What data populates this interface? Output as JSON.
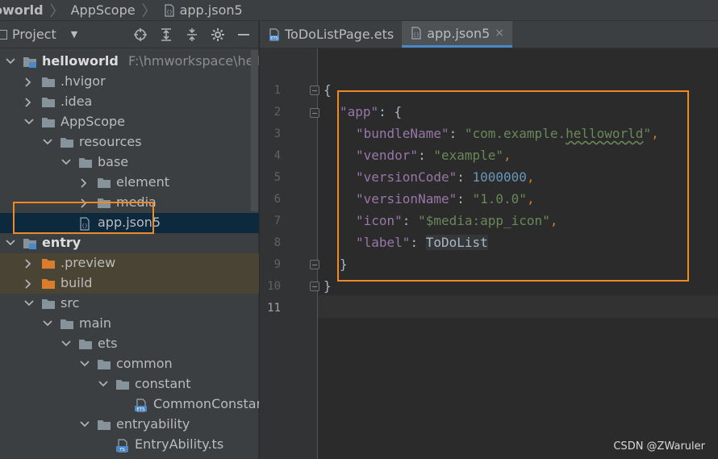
{
  "breadcrumb": {
    "items": [
      "oworld",
      "AppScope",
      "app.json5"
    ]
  },
  "project_panel": {
    "title": "Project",
    "tools": [
      "target-icon",
      "expand-all-icon",
      "collapse-all-icon",
      "gear-icon",
      "minimize-icon"
    ]
  },
  "tree": {
    "items": [
      {
        "label": "helloworld",
        "path": "F:\\hmworkspace\\hellowo",
        "kind": "module",
        "bold": true
      },
      {
        "label": ".hvigor",
        "kind": "folder"
      },
      {
        "label": ".idea",
        "kind": "folder"
      },
      {
        "label": "AppScope",
        "kind": "folder"
      },
      {
        "label": "resources",
        "kind": "folder"
      },
      {
        "label": "base",
        "kind": "folder"
      },
      {
        "label": "element",
        "kind": "folder"
      },
      {
        "label": "media",
        "kind": "folder"
      },
      {
        "label": "app.json5",
        "kind": "json"
      },
      {
        "label": "entry",
        "kind": "module",
        "bold": true
      },
      {
        "label": ".preview",
        "kind": "folder-orange"
      },
      {
        "label": "build",
        "kind": "folder-orange"
      },
      {
        "label": "src",
        "kind": "folder"
      },
      {
        "label": "main",
        "kind": "folder"
      },
      {
        "label": "ets",
        "kind": "folder"
      },
      {
        "label": "common",
        "kind": "folder"
      },
      {
        "label": "constant",
        "kind": "folder"
      },
      {
        "label": "CommonConstar",
        "kind": "ets"
      },
      {
        "label": "entryability",
        "kind": "folder"
      },
      {
        "label": "EntryAbility.ts",
        "kind": "ts"
      }
    ]
  },
  "tabs": [
    {
      "label": "ToDoListPage.ets",
      "active": false
    },
    {
      "label": "app.json5",
      "active": true
    }
  ],
  "tab_close_glyph": "×",
  "editor": {
    "line_numbers": [
      "1",
      "2",
      "3",
      "4",
      "5",
      "6",
      "7",
      "8",
      "9",
      "10",
      "11"
    ],
    "lines": {
      "l1": "{",
      "l2_key": "\"app\"",
      "l2_rest": ": {",
      "l3_key": "\"bundleName\"",
      "l3_val_a": "\"com.example.",
      "l3_val_b": "helloworld",
      "l3_val_c": "\"",
      "l4_key": "\"vendor\"",
      "l4_val": "\"example\"",
      "l5_key": "\"versionCode\"",
      "l5_val": "1000000",
      "l6_key": "\"versionName\"",
      "l6_val": "\"1.0.0\"",
      "l7_key": "\"icon\"",
      "l7_val": "\"$media:app_icon\"",
      "l8_key": "\"label\"",
      "l8_val": "ToDoList",
      "l9": "}",
      "l10": "}",
      "colon": ": ",
      "comma": ","
    }
  },
  "watermark": "CSDN @ZWaruler",
  "colors": {
    "highlight_box": "#f08a24",
    "selected_row": "#0d293e",
    "tab_underline": "#4a88c7"
  }
}
